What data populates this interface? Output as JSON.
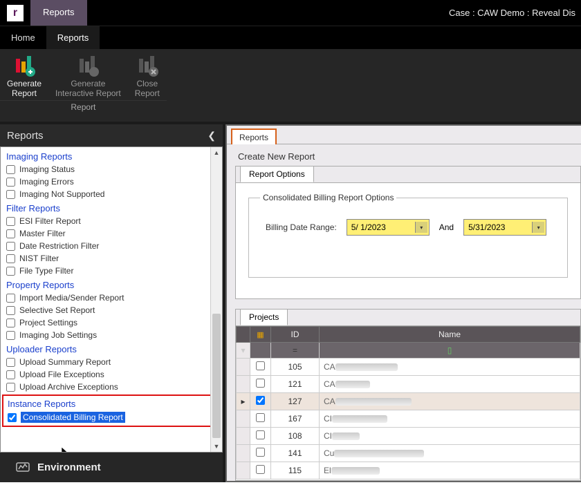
{
  "app": {
    "icon_letter": "r",
    "titlebar_tab": "Reports",
    "case_label": "Case : CAW Demo : Reveal Dis"
  },
  "nav": {
    "items": [
      "Home",
      "Reports"
    ],
    "active_index": 1
  },
  "ribbon": {
    "group_label": "Report",
    "buttons": [
      {
        "line1": "Generate",
        "line2": "Report",
        "enabled": true
      },
      {
        "line1": "Generate",
        "line2": "Interactive Report",
        "enabled": false
      },
      {
        "line1": "Close",
        "line2": "Report",
        "enabled": false
      }
    ]
  },
  "left": {
    "header": "Reports",
    "sections": [
      {
        "title": "Imaging Reports",
        "items": [
          {
            "label": "Imaging Status",
            "checked": false
          },
          {
            "label": "Imaging Errors",
            "checked": false
          },
          {
            "label": "Imaging Not Supported",
            "checked": false
          }
        ]
      },
      {
        "title": "Filter Reports",
        "items": [
          {
            "label": "ESI Filter Report",
            "checked": false
          },
          {
            "label": "Master Filter",
            "checked": false
          },
          {
            "label": "Date Restriction Filter",
            "checked": false
          },
          {
            "label": "NIST Filter",
            "checked": false
          },
          {
            "label": "File Type Filter",
            "checked": false
          }
        ]
      },
      {
        "title": "Property Reports",
        "items": [
          {
            "label": "Import Media/Sender Report",
            "checked": false
          },
          {
            "label": "Selective Set Report",
            "checked": false
          },
          {
            "label": "Project Settings",
            "checked": false
          },
          {
            "label": "Imaging Job Settings",
            "checked": false
          }
        ]
      },
      {
        "title": "Uploader Reports",
        "items": [
          {
            "label": "Upload Summary Report",
            "checked": false
          },
          {
            "label": "Upload File Exceptions",
            "checked": false
          },
          {
            "label": "Upload Archive Exceptions",
            "checked": false
          }
        ]
      }
    ],
    "highlighted_section": {
      "title": "Instance Reports",
      "item": {
        "label": "Consolidated Billing Report",
        "checked": true,
        "selected": true
      }
    },
    "env_label": "Environment"
  },
  "right": {
    "tab": "Reports",
    "heading": "Create New Report",
    "options_tab": "Report Options",
    "fieldset_legend": "Consolidated Billing Report Options",
    "date_label": "Billing Date Range:",
    "date_from": "5/ 1/2023",
    "date_and": "And",
    "date_to": "5/31/2023",
    "grid": {
      "tab": "Projects",
      "columns": {
        "sel_icon": "▦",
        "id": "ID",
        "name": "Name"
      },
      "filter_row": {
        "id_op": "=",
        "name_op": "▯"
      },
      "rows": [
        {
          "checked": false,
          "id": 105,
          "name_prefix": "CA",
          "indicator": false,
          "highlight": false,
          "blur_w": 90
        },
        {
          "checked": false,
          "id": 121,
          "name_prefix": "CA",
          "indicator": false,
          "highlight": false,
          "blur_w": 50
        },
        {
          "checked": true,
          "id": 127,
          "name_prefix": "CA",
          "indicator": true,
          "highlight": true,
          "blur_w": 110
        },
        {
          "checked": false,
          "id": 167,
          "name_prefix": "CI",
          "indicator": false,
          "highlight": false,
          "blur_w": 80
        },
        {
          "checked": false,
          "id": 108,
          "name_prefix": "CI",
          "indicator": false,
          "highlight": false,
          "blur_w": 40
        },
        {
          "checked": false,
          "id": 141,
          "name_prefix": "Cu",
          "indicator": false,
          "highlight": false,
          "blur_w": 130
        },
        {
          "checked": false,
          "id": 115,
          "name_prefix": "El",
          "indicator": false,
          "highlight": false,
          "blur_w": 70
        }
      ]
    }
  }
}
